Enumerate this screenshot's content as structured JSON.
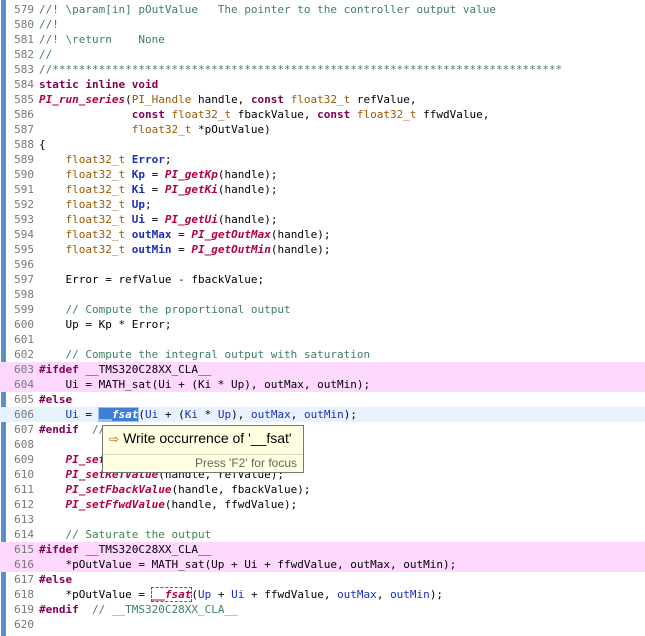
{
  "editor": {
    "lines": [
      {
        "n": "579",
        "t": "//! \\param[in] pOutValue   The pointer to the controller output value"
      },
      {
        "n": "580",
        "t": "//!"
      },
      {
        "n": "581",
        "t": "//! \\return    None"
      },
      {
        "n": "582",
        "t": "//"
      },
      {
        "n": "583",
        "t": "//*****************************************************************************"
      },
      {
        "n": "584",
        "t": "static inline void"
      },
      {
        "n": "585",
        "t": "PI_run_series(PI_Handle handle, const float32_t refValue,"
      },
      {
        "n": "586",
        "t": "              const float32_t fbackValue, const float32_t ffwdValue,"
      },
      {
        "n": "587",
        "t": "              float32_t *pOutValue)"
      },
      {
        "n": "588",
        "t": "{"
      },
      {
        "n": "589",
        "t": "    float32_t Error;"
      },
      {
        "n": "590",
        "t": "    float32_t Kp = PI_getKp(handle);"
      },
      {
        "n": "591",
        "t": "    float32_t Ki = PI_getKi(handle);"
      },
      {
        "n": "592",
        "t": "    float32_t Up;"
      },
      {
        "n": "593",
        "t": "    float32_t Ui = PI_getUi(handle);"
      },
      {
        "n": "594",
        "t": "    float32_t outMax = PI_getOutMax(handle);"
      },
      {
        "n": "595",
        "t": "    float32_t outMin = PI_getOutMin(handle);"
      },
      {
        "n": "596",
        "t": ""
      },
      {
        "n": "597",
        "t": "    Error = refValue - fbackValue;"
      },
      {
        "n": "598",
        "t": ""
      },
      {
        "n": "599",
        "t": "    // Compute the proportional output"
      },
      {
        "n": "600",
        "t": "    Up = Kp * Error;"
      },
      {
        "n": "601",
        "t": ""
      },
      {
        "n": "602",
        "t": "    // Compute the integral output with saturation"
      },
      {
        "n": "603",
        "t": "#ifdef __TMS320C28XX_CLA__"
      },
      {
        "n": "604",
        "t": "    Ui = MATH_sat(Ui + (Ki * Up), outMax, outMin);"
      },
      {
        "n": "605",
        "t": "#else"
      },
      {
        "n": "606",
        "t": "    Ui = __fsat(Ui + (Ki * Up), outMax, outMin);"
      },
      {
        "n": "607",
        "t": "#endif  // __TMS320C28XX_CLA__"
      },
      {
        "n": "608",
        "t": ""
      },
      {
        "n": "609",
        "t": "    PI_setUi(handle, Ui);"
      },
      {
        "n": "610",
        "t": "    PI_setRefValue(handle, refValue);"
      },
      {
        "n": "611",
        "t": "    PI_setFbackValue(handle, fbackValue);"
      },
      {
        "n": "612",
        "t": "    PI_setFfwdValue(handle, ffwdValue);"
      },
      {
        "n": "613",
        "t": ""
      },
      {
        "n": "614",
        "t": "    // Saturate the output"
      },
      {
        "n": "615",
        "t": "#ifdef __TMS320C28XX_CLA__"
      },
      {
        "n": "616",
        "t": "    *pOutValue = MATH_sat(Up + Ui + ffwdValue, outMax, outMin);"
      },
      {
        "n": "617",
        "t": "#else"
      },
      {
        "n": "618",
        "t": "    *pOutValue = __fsat(Up + Ui + ffwdValue, outMax, outMin);"
      },
      {
        "n": "619",
        "t": "#endif  // __TMS320C28XX_CLA__"
      },
      {
        "n": "620",
        "t": ""
      }
    ]
  },
  "tooltip": {
    "title": "Write occurrence of '__fsat'",
    "hint": "Press 'F2' for focus",
    "icon": "arrow-right-icon"
  },
  "colors": {
    "preprocessor_bg": "#ffd8ff",
    "current_line_bg": "#e8f2fe",
    "comment": "#3f7f5f",
    "keyword": "#7f0055",
    "occurrence": "#3d7fd6"
  }
}
